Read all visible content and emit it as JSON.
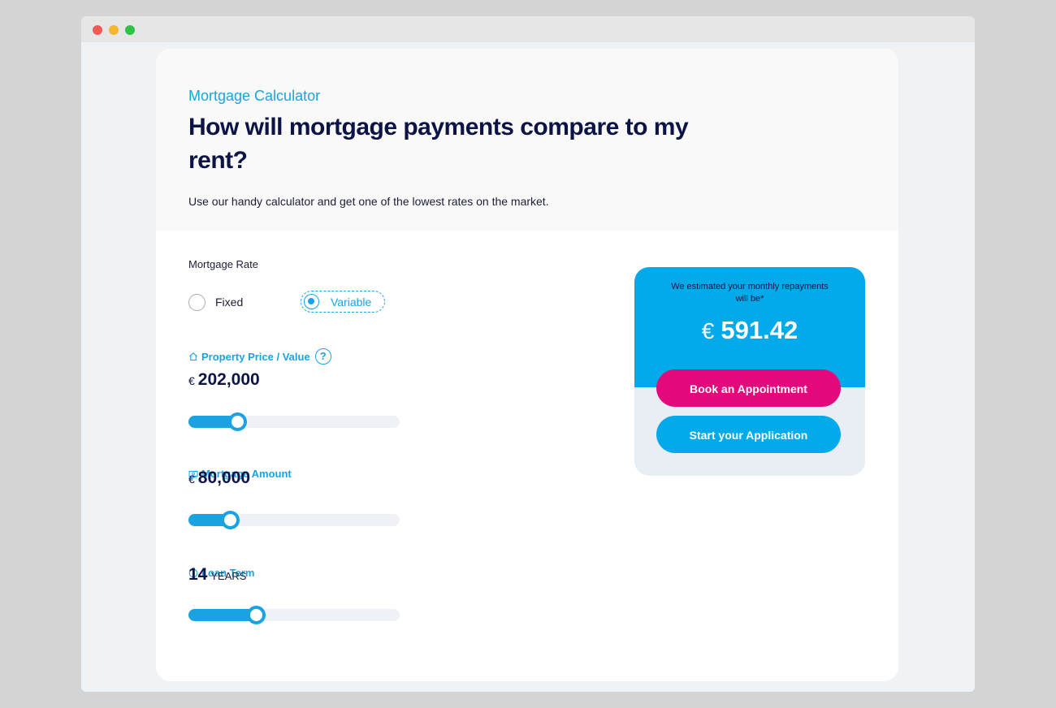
{
  "calculator": {
    "eyebrow": "Mortgage Calculator",
    "headline": "How will mortgage payments compare to my rent?",
    "intro": "Use our handy calculator and get one of the lowest rates on the market."
  },
  "rate": {
    "label": "Mortgage Rate",
    "options": [
      {
        "label": "Fixed",
        "selected": false
      },
      {
        "label": "Variable",
        "selected": true
      }
    ]
  },
  "property": {
    "label": "Property Price / Value",
    "icon": "house-icon",
    "help_glyph": "?",
    "currency": "€",
    "value": "202,000",
    "slider_fraction": 0.23
  },
  "mortgage": {
    "label": "Mortgage Amount",
    "icon": "money-icon",
    "currency": "€",
    "value": "80,000",
    "slider_fraction": 0.195
  },
  "term": {
    "label": "Loan Term",
    "icon": "clock-icon",
    "value": "14",
    "unit": "YEARS",
    "slider_fraction": 0.32
  },
  "result": {
    "caption": "We estimated your monthly repayments will be*",
    "currency": "€",
    "amount": "591.42",
    "book_label": "Book an Appointment",
    "start_label": "Start your Application"
  },
  "colors": {
    "accent": "#1aa3e0",
    "brand_blue": "#03aaea",
    "navy": "#0c1446",
    "pink": "#e5087c"
  }
}
